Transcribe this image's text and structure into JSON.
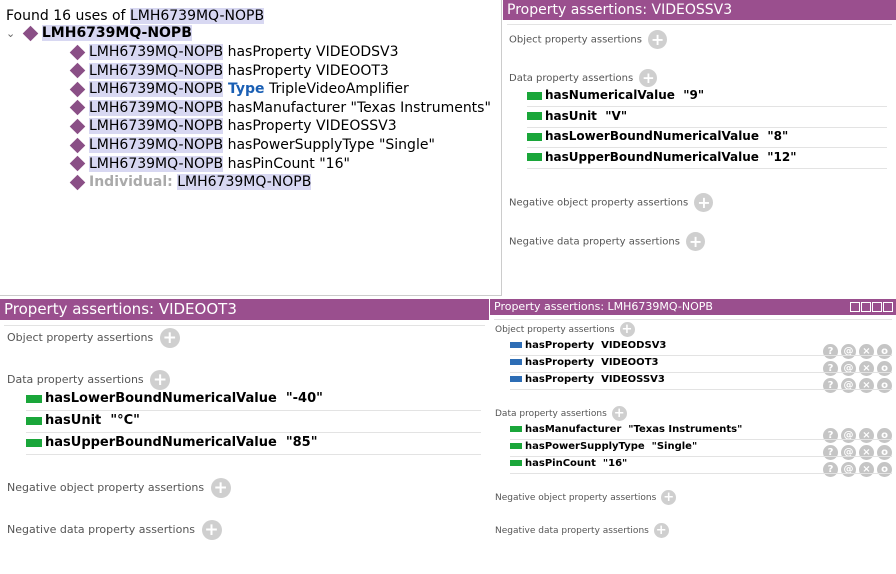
{
  "usage": {
    "found_text": "Found 16 uses of ",
    "entity": "LMH6739MQ-NOPB",
    "root": "LMH6739MQ-NOPB",
    "items": [
      {
        "subject": "LMH6739MQ-NOPB",
        "rest": " hasProperty VIDEODSV3",
        "keyword": ""
      },
      {
        "subject": "LMH6739MQ-NOPB",
        "rest": " hasProperty VIDEOOT3",
        "keyword": ""
      },
      {
        "subject": "LMH6739MQ-NOPB",
        "keyword": " Type",
        "rest": " TripleVideoAmplifier"
      },
      {
        "subject": "LMH6739MQ-NOPB",
        "rest": " hasManufacturer \"Texas Instruments\"",
        "keyword": ""
      },
      {
        "subject": "LMH6739MQ-NOPB",
        "rest": " hasProperty VIDEOSSV3",
        "keyword": ""
      },
      {
        "subject": "LMH6739MQ-NOPB",
        "rest": " hasPowerSupplyType \"Single\"",
        "keyword": ""
      },
      {
        "subject": "LMH6739MQ-NOPB",
        "rest": " hasPinCount \"16\"",
        "keyword": ""
      }
    ],
    "individual_label": "Individual:",
    "individual_value": "LMH6739MQ-NOPB"
  },
  "panel_ssv3": {
    "title": "Property assertions: VIDEOSSV3",
    "object_label": "Object property assertions",
    "data_label": "Data property assertions",
    "data": [
      {
        "prop": "hasNumericalValue",
        "val": "\"9\""
      },
      {
        "prop": "hasUnit",
        "val": "\"V\""
      },
      {
        "prop": "hasLowerBoundNumericalValue",
        "val": "\"8\""
      },
      {
        "prop": "hasUpperBoundNumericalValue",
        "val": "\"12\""
      }
    ],
    "neg_object_label": "Negative object property assertions",
    "neg_data_label": "Negative data property assertions"
  },
  "panel_ot3": {
    "title": "Property assertions: VIDEOOT3",
    "object_label": "Object property assertions",
    "data_label": "Data property assertions",
    "data": [
      {
        "prop": "hasLowerBoundNumericalValue",
        "val": "\"-40\""
      },
      {
        "prop": "hasUnit",
        "val": "\"°C\""
      },
      {
        "prop": "hasUpperBoundNumericalValue",
        "val": "\"85\""
      }
    ],
    "neg_object_label": "Negative object property assertions",
    "neg_data_label": "Negative data property assertions"
  },
  "panel_main": {
    "title": "Property assertions: LMH6739MQ-NOPB",
    "object_label": "Object property assertions",
    "objects": [
      {
        "prop": "hasProperty",
        "val": "VIDEODSV3"
      },
      {
        "prop": "hasProperty",
        "val": "VIDEOOT3"
      },
      {
        "prop": "hasProperty",
        "val": "VIDEOSSV3"
      }
    ],
    "data_label": "Data property assertions",
    "data": [
      {
        "prop": "hasManufacturer",
        "val": "\"Texas Instruments\""
      },
      {
        "prop": "hasPowerSupplyType",
        "val": "\"Single\""
      },
      {
        "prop": "hasPinCount",
        "val": "\"16\""
      }
    ],
    "neg_object_label": "Negative object property assertions",
    "neg_data_label": "Negative data property assertions",
    "controls": [
      "?",
      "@",
      "×",
      "o"
    ]
  },
  "colors": {
    "header": "#9a4f8e",
    "highlight": "#d8d8f2",
    "data_bar": "#1aa63a",
    "object_bar": "#2d6db5",
    "type_keyword": "#1a5fb4"
  }
}
